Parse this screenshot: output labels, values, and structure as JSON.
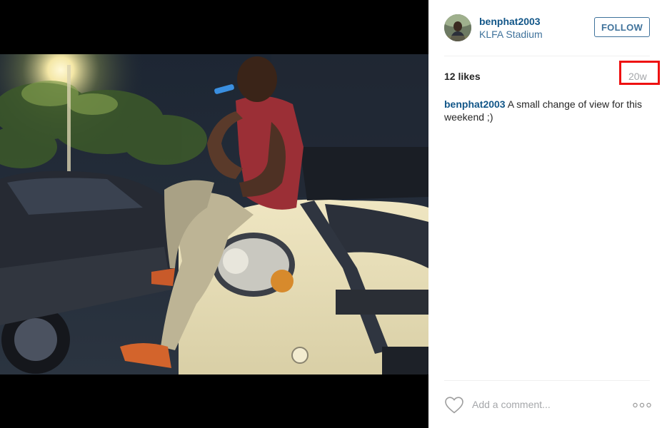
{
  "post": {
    "username": "benphat2003",
    "location": "KLFA Stadium",
    "follow_label": "FOLLOW",
    "likes": "12 likes",
    "timestamp": "20w",
    "caption_user": "benphat2003",
    "caption_text": "A small change of view for this weekend ;)",
    "comment_placeholder": "Add a comment..."
  },
  "icons": {
    "like": "heart-icon",
    "options": "more-options-icon"
  },
  "colors": {
    "link": "#125688",
    "follow_blue": "#3f729b",
    "muted": "#a5a7aa",
    "highlight_box": "#ee1111"
  }
}
